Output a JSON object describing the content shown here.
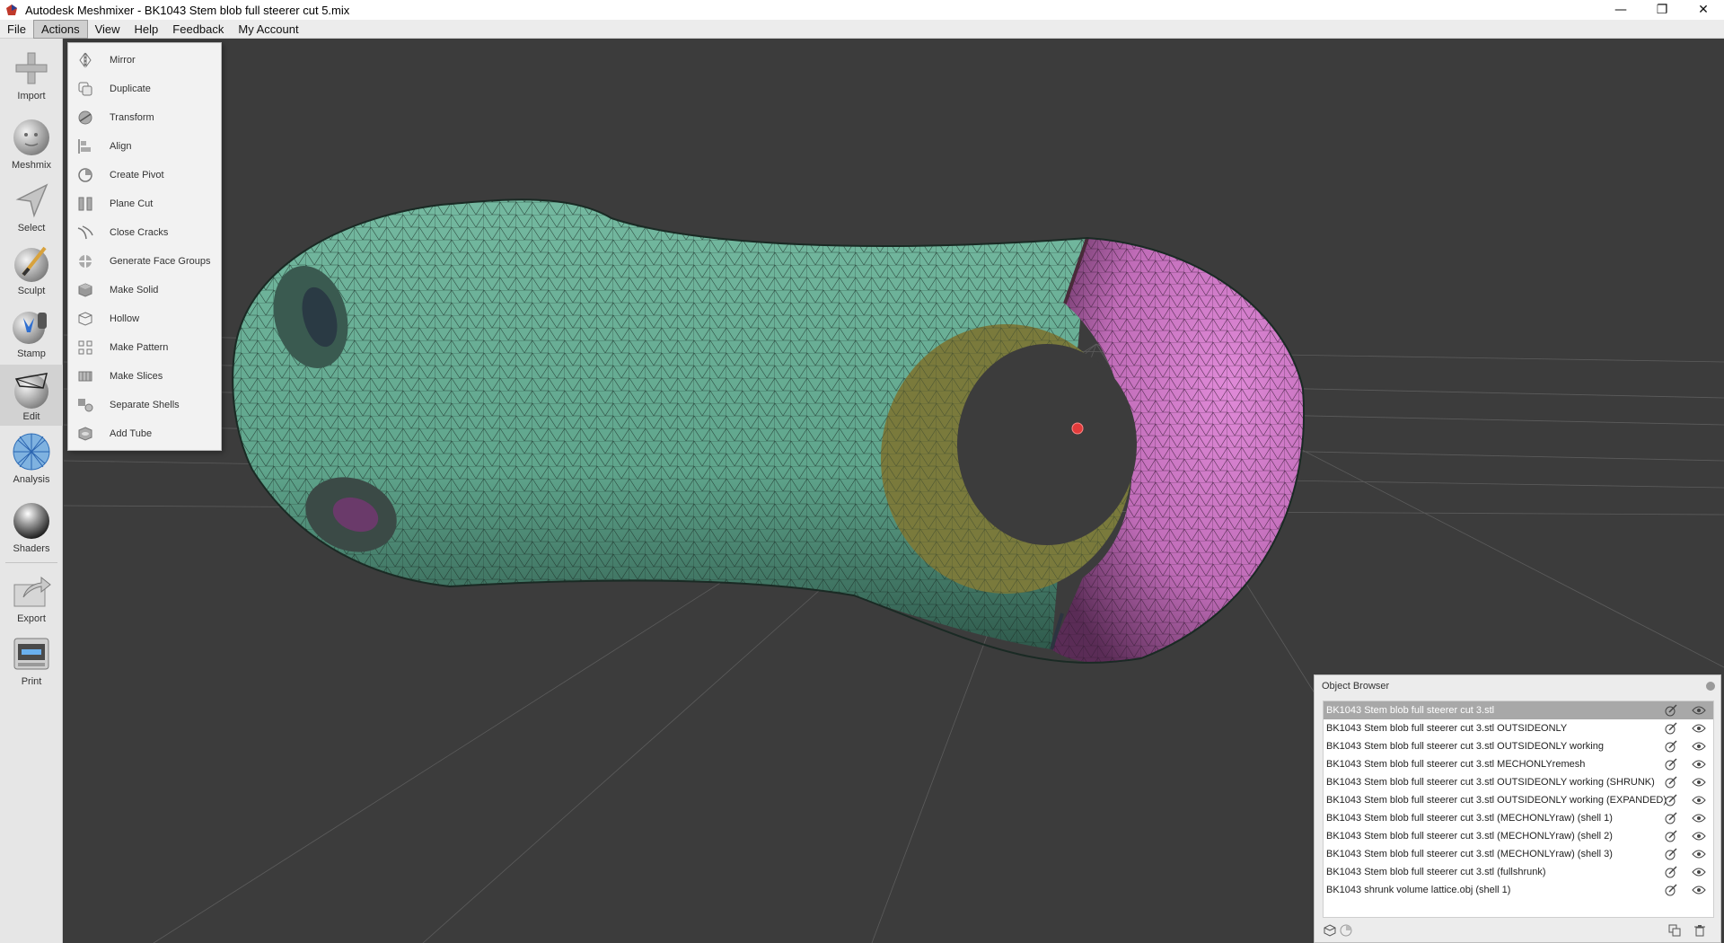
{
  "window": {
    "title": "Autodesk Meshmixer - BK1043 Stem blob full steerer cut 5.mix",
    "minimize_glyph": "—",
    "restore_glyph": "❐",
    "close_glyph": "✕"
  },
  "menubar": {
    "items": [
      "File",
      "Actions",
      "View",
      "Help",
      "Feedback",
      "My Account"
    ],
    "active": "Actions"
  },
  "toolbar": {
    "tools": [
      {
        "label": "Import",
        "icon": "plus-icon"
      },
      {
        "label": "Meshmix",
        "icon": "face-sphere-icon"
      },
      {
        "label": "Select",
        "icon": "arrow-cursor-icon"
      },
      {
        "label": "Sculpt",
        "icon": "brush-sphere-icon"
      },
      {
        "label": "Stamp",
        "icon": "stamp-icon"
      },
      {
        "label": "Edit",
        "icon": "edit-sphere-icon"
      },
      {
        "label": "Analysis",
        "icon": "mesh-sphere-icon"
      },
      {
        "label": "Shaders",
        "icon": "chrome-sphere-icon"
      },
      {
        "label": "Export",
        "icon": "export-icon"
      },
      {
        "label": "Print",
        "icon": "printer-icon"
      }
    ],
    "selected": "Edit"
  },
  "actions_menu": {
    "items": [
      {
        "label": "Mirror",
        "icon": "mirror-icon"
      },
      {
        "label": "Duplicate",
        "icon": "duplicate-icon"
      },
      {
        "label": "Transform",
        "icon": "transform-icon"
      },
      {
        "label": "Align",
        "icon": "align-icon"
      },
      {
        "label": "Create Pivot",
        "icon": "pivot-icon"
      },
      {
        "label": "Plane Cut",
        "icon": "plane-cut-icon"
      },
      {
        "label": "Close Cracks",
        "icon": "close-cracks-icon"
      },
      {
        "label": "Generate Face Groups",
        "icon": "face-groups-icon"
      },
      {
        "label": "Make Solid",
        "icon": "make-solid-icon"
      },
      {
        "label": "Hollow",
        "icon": "hollow-icon"
      },
      {
        "label": "Make Pattern",
        "icon": "make-pattern-icon"
      },
      {
        "label": "Make Slices",
        "icon": "make-slices-icon"
      },
      {
        "label": "Separate Shells",
        "icon": "separate-shells-icon"
      },
      {
        "label": "Add Tube",
        "icon": "add-tube-icon"
      }
    ]
  },
  "object_browser": {
    "title": "Object Browser",
    "objects": [
      "BK1043 Stem blob full steerer cut 3.stl",
      "BK1043 Stem blob full steerer cut 3.stl OUTSIDEONLY",
      "BK1043 Stem blob full steerer cut 3.stl OUTSIDEONLY working",
      "BK1043 Stem blob full steerer cut 3.stl MECHONLYremesh",
      "BK1043 Stem blob full steerer cut 3.stl OUTSIDEONLY working (SHRUNK)",
      "BK1043 Stem blob full steerer cut 3.stl OUTSIDEONLY working (EXPANDED)",
      "BK1043 Stem blob full steerer cut 3.stl (MECHONLYraw) (shell 1)",
      "BK1043 Stem blob full steerer cut 3.stl (MECHONLYraw) (shell 2)",
      "BK1043 Stem blob full steerer cut 3.stl (MECHONLYraw) (shell 3)",
      "BK1043 Stem blob full steerer cut 3.stl (fullshrunk)",
      "BK1043 shrunk volume lattice.obj (shell 1)"
    ],
    "selected_index": 0
  },
  "colors": {
    "mesh_green": "#5fa58c",
    "mesh_pink": "#c873c0",
    "mesh_yellow": "#808040",
    "pivot_red": "#e23b3b",
    "viewport_bg": "#3c3c3c"
  }
}
